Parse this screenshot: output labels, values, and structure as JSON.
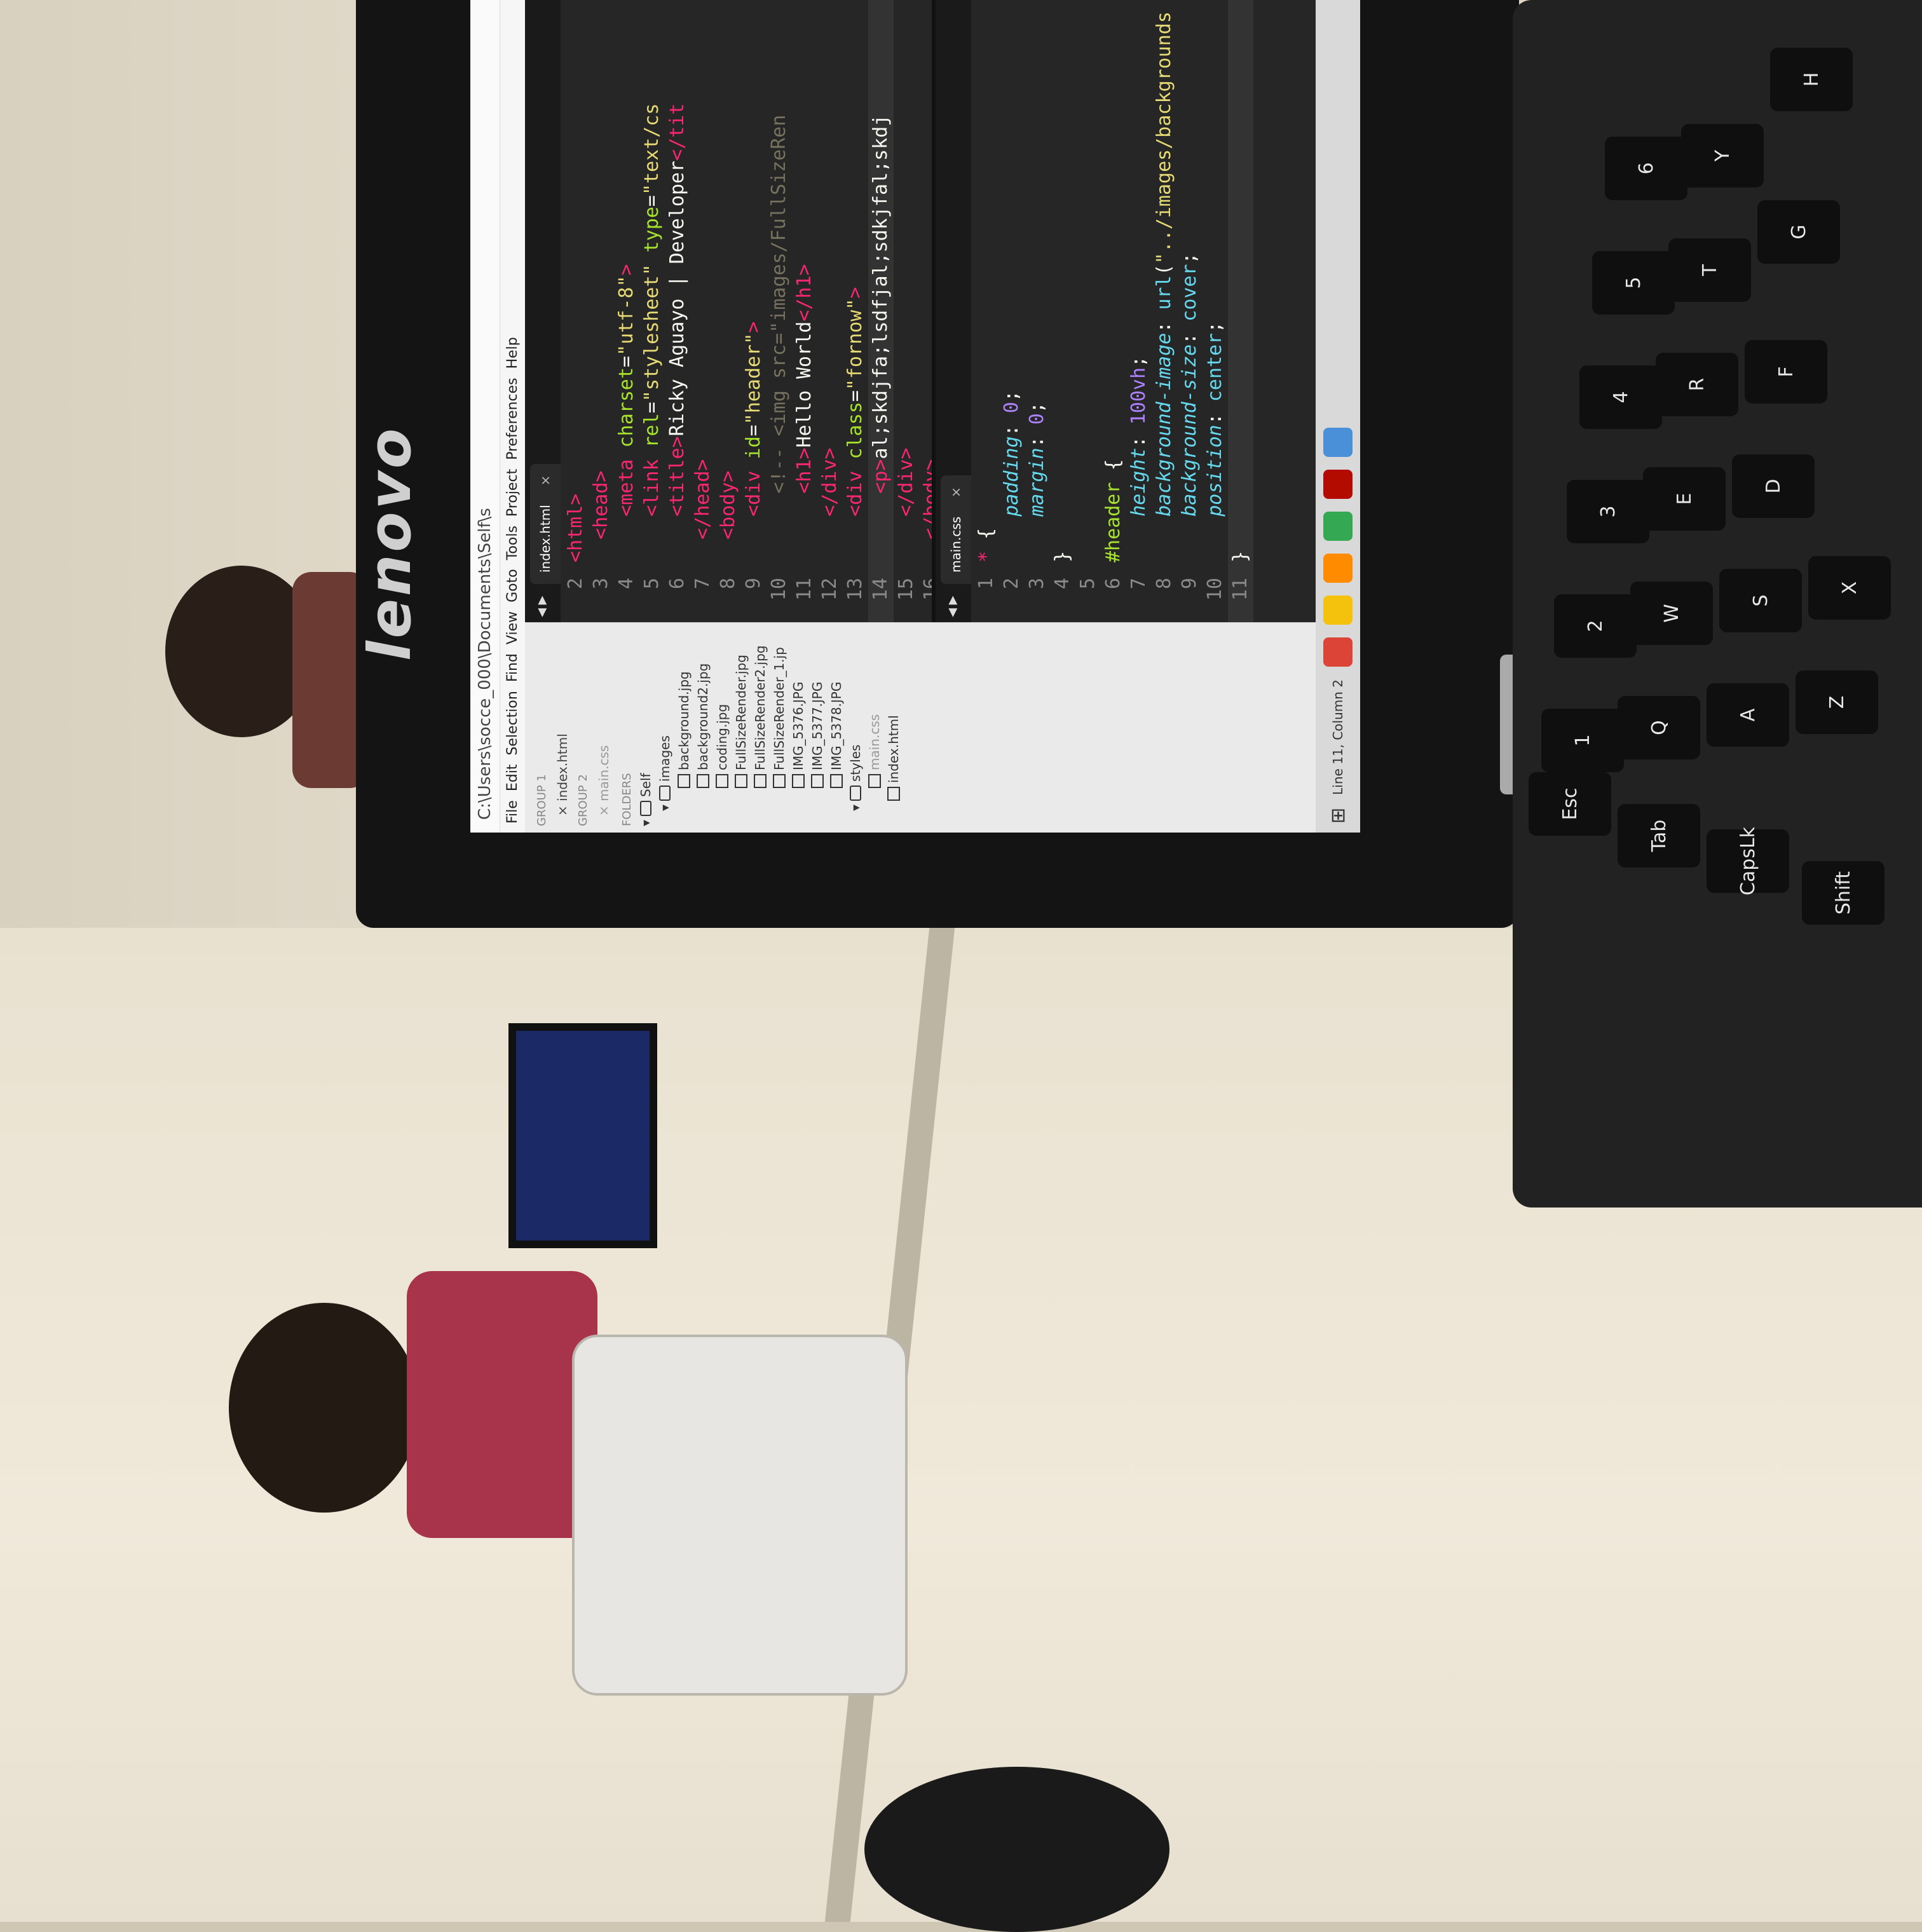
{
  "window": {
    "title": "C:\\Users\\socce_000\\Documents\\Self\\s"
  },
  "menu": [
    "File",
    "Edit",
    "Selection",
    "Find",
    "View",
    "Goto",
    "Tools",
    "Project",
    "Preferences",
    "Help"
  ],
  "sidebar": {
    "group1": "GROUP 1",
    "group1_file": "index.html",
    "group2": "GROUP 2",
    "group2_file": "main.css",
    "folders_label": "FOLDERS",
    "root": "Self",
    "images_folder": "images",
    "images": [
      "background.jpg",
      "background2.jpg",
      "coding.jpg",
      "FullSizeRender.jpg",
      "FullSizeRender2.jpg",
      "FullSizeRender_1.jp",
      "IMG_5376.JPG",
      "IMG_5377.JPG",
      "IMG_5378.JPG"
    ],
    "styles_folder": "styles",
    "styles_files": [
      "main.css"
    ],
    "root_files": [
      "index.html"
    ]
  },
  "editor_top": {
    "tab": "index.html",
    "line_numbers": [
      "2",
      "3",
      "4",
      "5",
      "6",
      "7",
      "8",
      "9",
      "10",
      "11",
      "12",
      "13",
      "14",
      "15",
      "16"
    ]
  },
  "editor_bottom": {
    "tab": "main.css",
    "line_numbers": [
      "1",
      "2",
      "3",
      "4",
      "5",
      "6",
      "7",
      "8",
      "9",
      "10",
      "11"
    ]
  },
  "status": {
    "position": "Line 11, Column 2"
  },
  "laptop": {
    "brand": "lenovo"
  },
  "keys": [
    "Esc",
    "Tab",
    "CapsLk",
    "Shift",
    "Q",
    "W",
    "E",
    "R",
    "T",
    "Y",
    "A",
    "S",
    "D",
    "F",
    "G",
    "H",
    "Z",
    "X",
    "1",
    "2",
    "3",
    "4",
    "5",
    "6"
  ]
}
